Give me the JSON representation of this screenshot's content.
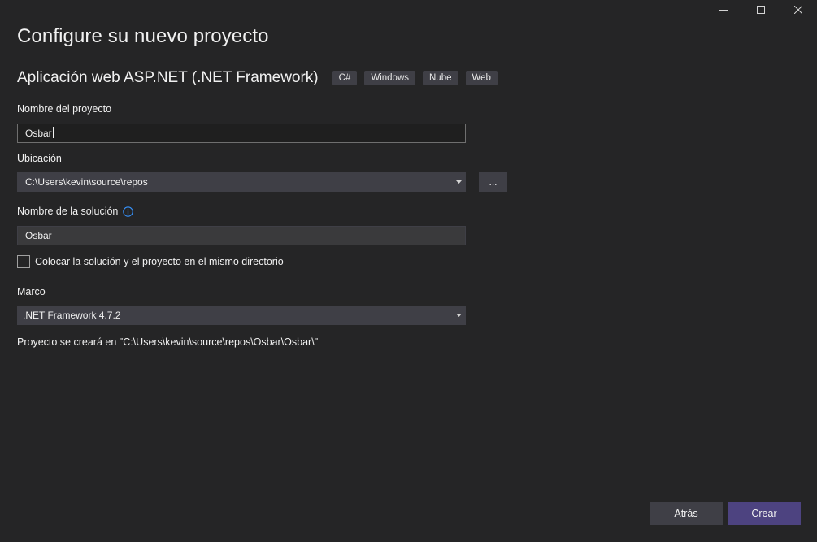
{
  "window": {
    "controls": [
      "minimize-icon",
      "maximize-icon",
      "close-icon"
    ]
  },
  "title": "Configure su nuevo proyecto",
  "template": {
    "name": "Aplicación web ASP.NET (.NET Framework)",
    "tags": [
      "C#",
      "Windows",
      "Nube",
      "Web"
    ]
  },
  "form": {
    "project_name_label": "Nombre del proyecto",
    "project_name_value": "Osbar",
    "location_label": "Ubicación",
    "location_value": "C:\\Users\\kevin\\source\\repos",
    "browse_label": "...",
    "solution_name_label": "Nombre de la solución",
    "solution_name_value": "Osbar",
    "same_dir_label": "Colocar la solución y el proyecto en el mismo directorio",
    "same_dir_checked": false,
    "framework_label": "Marco",
    "framework_value": ".NET Framework 4.7.2"
  },
  "path_info": "Proyecto se creará en \"C:\\Users\\kevin\\source\\repos\\Osbar\\Osbar\\\"",
  "buttons": {
    "back": "Atrás",
    "create": "Crear"
  },
  "colors": {
    "background": "#252526",
    "accent": "#4d4380",
    "info": "#3794ff"
  }
}
